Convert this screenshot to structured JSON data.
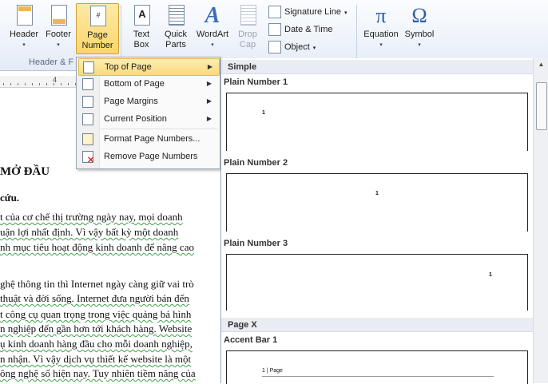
{
  "ribbon": {
    "buttons": [
      {
        "label": "Header",
        "dropdown": true
      },
      {
        "label": "Footer",
        "dropdown": true
      },
      {
        "label": "Page\nNumber",
        "dropdown": true,
        "active": true
      },
      {
        "label": "Text\nBox",
        "dropdown": true
      },
      {
        "label": "Quick\nParts",
        "dropdown": true
      },
      {
        "label": "WordArt",
        "dropdown": true
      },
      {
        "label": "Drop\nCap",
        "dropdown": true,
        "disabled": true
      },
      {
        "label": "Equation",
        "dropdown": true
      },
      {
        "label": "Symbol",
        "dropdown": true
      }
    ],
    "group_label": "Header & F",
    "small_items": [
      "Signature Line",
      "Date & Time",
      "Object"
    ],
    "equation_glyph": "π",
    "symbol_glyph": "Ω",
    "wordart_glyph": "A"
  },
  "ruler": {
    "number": "4"
  },
  "document": {
    "lines": [
      "MỞ ĐẦU",
      "cứu.",
      "t của cơ chế thị trường ngày nay, mọi doanh",
      "uận lợi nhất định. Vì vậy bất kỳ một doanh",
      "nh mục tiêu hoạt động kinh doanh để nâng cao",
      "ghệ thông tin thì Internet ngày càng giữ vai trò",
      " thuật và đời sống. Internet đưa người bán đến",
      "t công cụ quan trọng trong việc quảng bá hình",
      "n nghiệp đến gần hơn tới khách hàng. Website",
      "ụ kinh doanh hàng đầu cho mỗi doanh nghiệp,",
      "n nhận. Vì vậy dịch vụ thiết kế website là một",
      "ông nghệ số hiện nay. Tuy nhiên tiềm năng của"
    ]
  },
  "menu": {
    "items": [
      {
        "label": "Top of Page",
        "submenu": true,
        "highlighted": true
      },
      {
        "label": "Bottom of Page",
        "submenu": true
      },
      {
        "label": "Page Margins",
        "submenu": true
      },
      {
        "label": "Current Position",
        "submenu": true
      },
      {
        "label": "Format Page Numbers..."
      },
      {
        "label": "Remove Page Numbers"
      }
    ]
  },
  "gallery": {
    "section_simple": "Simple",
    "section_pagex": "Page X",
    "items": [
      {
        "title": "Plain Number 1",
        "page_text": "1"
      },
      {
        "title": "Plain Number 2",
        "page_text": "1"
      },
      {
        "title": "Plain Number 3",
        "page_text": "1"
      },
      {
        "title": "Accent Bar 1",
        "page_text": "1 | Page"
      }
    ]
  },
  "colors": {
    "accent": "#fbd97c",
    "ribbon_bg": "#eef3fa",
    "squiggle": "#3fa14a"
  }
}
